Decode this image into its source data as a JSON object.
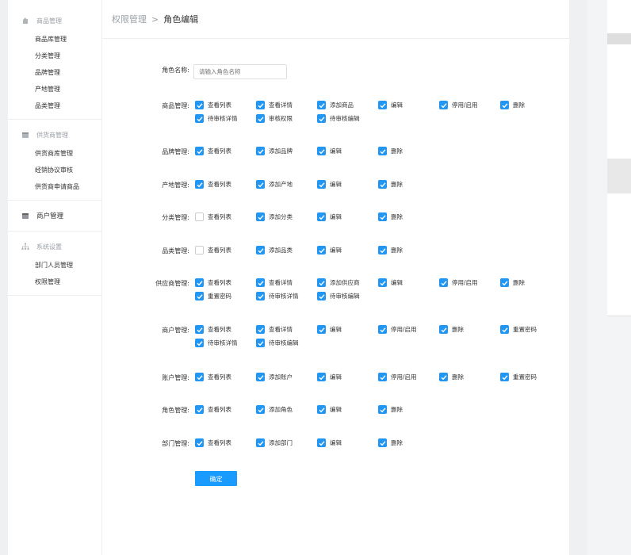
{
  "sidebar": {
    "groups": [
      {
        "title": "商品管理",
        "icon": "goods-icon",
        "items": [
          "商品库管理",
          "分类管理",
          "品牌管理",
          "产地管理",
          "品类管理"
        ]
      },
      {
        "title": "供货商管理",
        "icon": "supplier-icon",
        "items": [
          "供货商库管理",
          "经销协议审核",
          "供货商申请商品"
        ]
      },
      {
        "title": "商户管理",
        "icon": "merchant-icon",
        "items": []
      },
      {
        "title": "系统设置",
        "icon": "settings-icon",
        "items": [
          "部门人员管理",
          "权限管理"
        ]
      }
    ]
  },
  "breadcrumb": {
    "parent": "权限管理",
    "separator": ">",
    "current": "角色编辑"
  },
  "form": {
    "name_label": "角色名称:",
    "name_placeholder": "请输入角色名称",
    "submit_label": "确定",
    "sections": [
      {
        "label": "商品管理:",
        "options": [
          {
            "text": "查看列表",
            "checked": true
          },
          {
            "text": "查看详情",
            "checked": true
          },
          {
            "text": "添加商品",
            "checked": true
          },
          {
            "text": "编辑",
            "checked": true
          },
          {
            "text": "停用/启用",
            "checked": true
          },
          {
            "text": "删除",
            "checked": true
          },
          {
            "text": "待审核详情",
            "checked": true
          },
          {
            "text": "审核权限",
            "checked": true
          },
          {
            "text": "待审核编辑",
            "checked": true
          }
        ]
      },
      {
        "label": "品牌管理:",
        "options": [
          {
            "text": "查看列表",
            "checked": true
          },
          {
            "text": "添加品牌",
            "checked": true
          },
          {
            "text": "编辑",
            "checked": true
          },
          {
            "text": "删除",
            "checked": true
          }
        ]
      },
      {
        "label": "产地管理:",
        "options": [
          {
            "text": "查看列表",
            "checked": true
          },
          {
            "text": "添加产地",
            "checked": true
          },
          {
            "text": "编辑",
            "checked": true
          },
          {
            "text": "删除",
            "checked": true
          }
        ]
      },
      {
        "label": "分类管理:",
        "options": [
          {
            "text": "查看列表",
            "checked": false
          },
          {
            "text": "添加分类",
            "checked": true
          },
          {
            "text": "编辑",
            "checked": true
          },
          {
            "text": "删除",
            "checked": true
          }
        ]
      },
      {
        "label": "品类管理:",
        "options": [
          {
            "text": "查看列表",
            "checked": false
          },
          {
            "text": "添加品类",
            "checked": true
          },
          {
            "text": "编辑",
            "checked": true
          },
          {
            "text": "删除",
            "checked": true
          }
        ]
      },
      {
        "label": "供应商管理:",
        "options": [
          {
            "text": "查看列表",
            "checked": true
          },
          {
            "text": "查看详情",
            "checked": true
          },
          {
            "text": "添加供应商",
            "checked": true
          },
          {
            "text": "编辑",
            "checked": true
          },
          {
            "text": "停用/启用",
            "checked": true
          },
          {
            "text": "删除",
            "checked": true
          },
          {
            "text": "重置密码",
            "checked": true
          },
          {
            "text": "待审核详情",
            "checked": true
          },
          {
            "text": "待审核编辑",
            "checked": true
          }
        ]
      },
      {
        "label": "商户管理:",
        "options": [
          {
            "text": "查看列表",
            "checked": true
          },
          {
            "text": "查看详情",
            "checked": true
          },
          {
            "text": "编辑",
            "checked": true
          },
          {
            "text": "停用/启用",
            "checked": true
          },
          {
            "text": "删除",
            "checked": true
          },
          {
            "text": "重置密码",
            "checked": true
          },
          {
            "text": "待审核详情",
            "checked": true
          },
          {
            "text": "待审核编辑",
            "checked": true
          }
        ]
      },
      {
        "label": "账户管理:",
        "options": [
          {
            "text": "查看列表",
            "checked": true
          },
          {
            "text": "添加账户",
            "checked": true
          },
          {
            "text": "编辑",
            "checked": true
          },
          {
            "text": "停用/启用",
            "checked": true
          },
          {
            "text": "删除",
            "checked": true
          },
          {
            "text": "重置密码",
            "checked": true
          }
        ]
      },
      {
        "label": "角色管理:",
        "options": [
          {
            "text": "查看列表",
            "checked": true
          },
          {
            "text": "添加角色",
            "checked": true
          },
          {
            "text": "编辑",
            "checked": true
          },
          {
            "text": "删除",
            "checked": true
          }
        ]
      },
      {
        "label": "部门管理:",
        "options": [
          {
            "text": "查看列表",
            "checked": true
          },
          {
            "text": "添加部门",
            "checked": true
          },
          {
            "text": "编辑",
            "checked": true
          },
          {
            "text": "删除",
            "checked": true
          }
        ]
      }
    ]
  },
  "colors": {
    "accent": "#2196f3",
    "button": "#1a9bff",
    "muted_text": "#9aa0a6"
  }
}
